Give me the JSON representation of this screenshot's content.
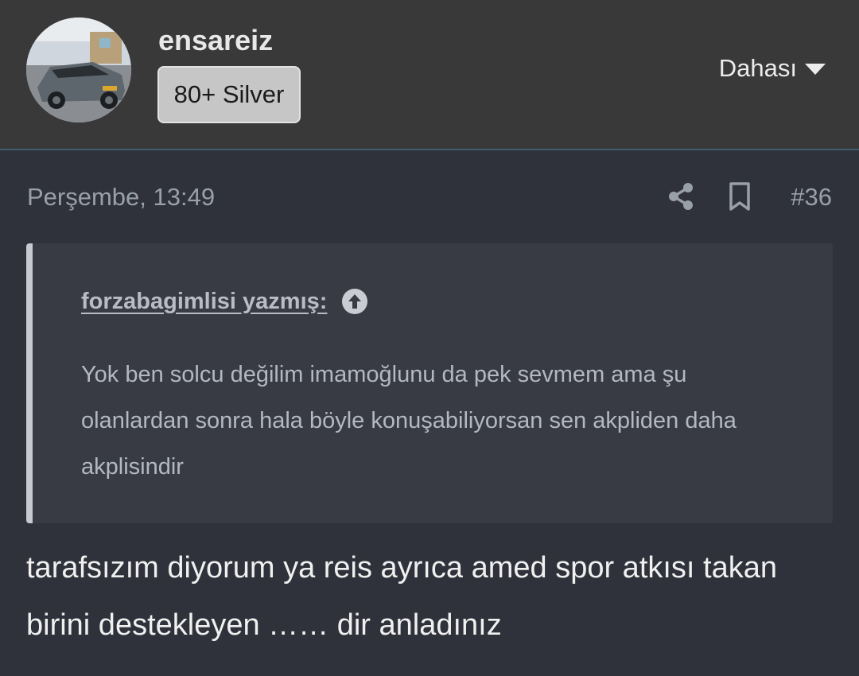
{
  "user": {
    "name": "ensareiz",
    "badge": "80+ Silver"
  },
  "header": {
    "more_label": "Dahası"
  },
  "post": {
    "date": "Perşembe, 13:49",
    "number": "#36",
    "quote": {
      "author_line": "forzabagimlisi yazmış:",
      "text": "Yok ben solcu değilim imamoğlunu da pek sevmem ama şu olanlardan sonra hala böyle konuşabiliyorsan sen akpliden daha akplisindir"
    },
    "body": "tarafsızım diyorum ya reis ayrıca amed spor atkısı takan birini destekleyen …… dir anladınız"
  },
  "icons": {
    "avatar": "avatar-car-photo",
    "share": "share-icon",
    "bookmark": "bookmark-icon",
    "more": "chevron-down-icon",
    "quote_jump": "arrow-up-circle-icon"
  }
}
